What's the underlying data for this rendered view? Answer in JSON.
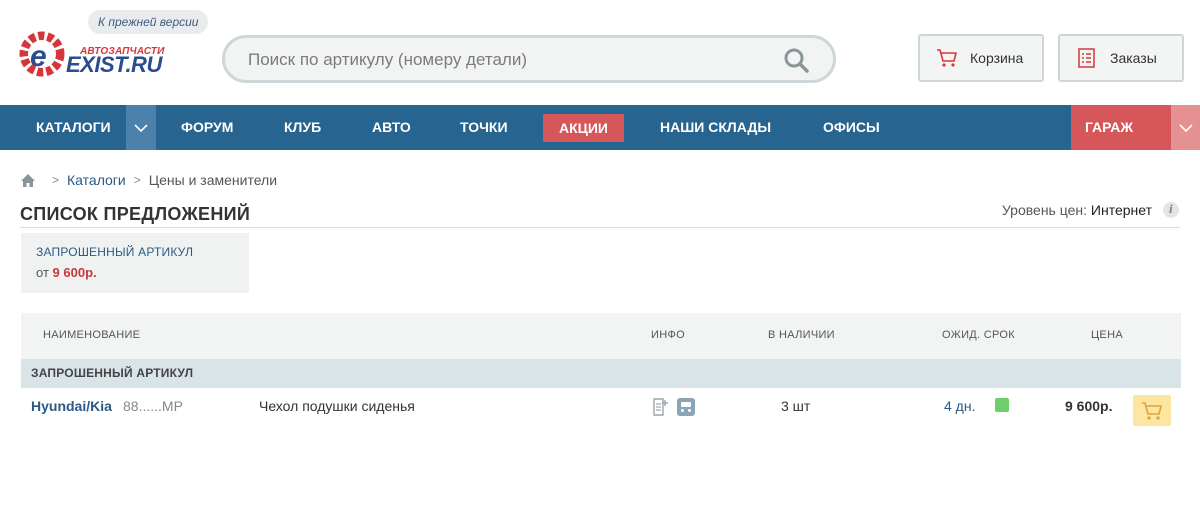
{
  "header": {
    "logo_subtitle": "АВТОЗАПЧАСТИ",
    "logo_text": "EXIST.RU",
    "old_version_label": "К прежней версии",
    "search": {
      "placeholder": "Поиск по артикулу (номеру детали)"
    },
    "cart_label": "Корзина",
    "orders_label": "Заказы"
  },
  "nav": {
    "catalogs": "КАТАЛОГИ",
    "forum": "ФОРУМ",
    "club": "КЛУБ",
    "auto": "АВТО",
    "points": "ТОЧКИ",
    "promo": "АКЦИИ",
    "warehouses": "НАШИ СКЛАДЫ",
    "offices": "ОФИСЫ",
    "garage": "ГАРАЖ"
  },
  "breadcrumbs": {
    "catalogs": "Каталоги",
    "current": "Цены и заменители"
  },
  "page": {
    "title": "СПИСОК ПРЕДЛОЖЕНИЙ",
    "price_level_label": "Уровень цен:",
    "price_level_value": "Интернет"
  },
  "requested": {
    "label": "ЗАПРОШЕННЫЙ АРТИКУЛ",
    "price_prefix": "от",
    "price": "9 600р."
  },
  "table": {
    "headers": {
      "name": "НАИМЕНОВАНИЕ",
      "info": "ИНФО",
      "stock": "В НАЛИЧИИ",
      "term": "ОЖИД. СРОК",
      "price": "ЦЕНА"
    },
    "group": "ЗАПРОШЕННЫЙ АРТИКУЛ",
    "row": {
      "brand": "Hyundai/Kia",
      "article": "88......MP",
      "description": "Чехол подушки сиденья",
      "stock": "3 шт",
      "term": "4 дн.",
      "price": "9 600р."
    }
  },
  "colors": {
    "nav_blue": "#276490",
    "accent_red": "#d6575a",
    "cart_yellow": "#fde7a0",
    "term_green": "#6ccf6a"
  }
}
